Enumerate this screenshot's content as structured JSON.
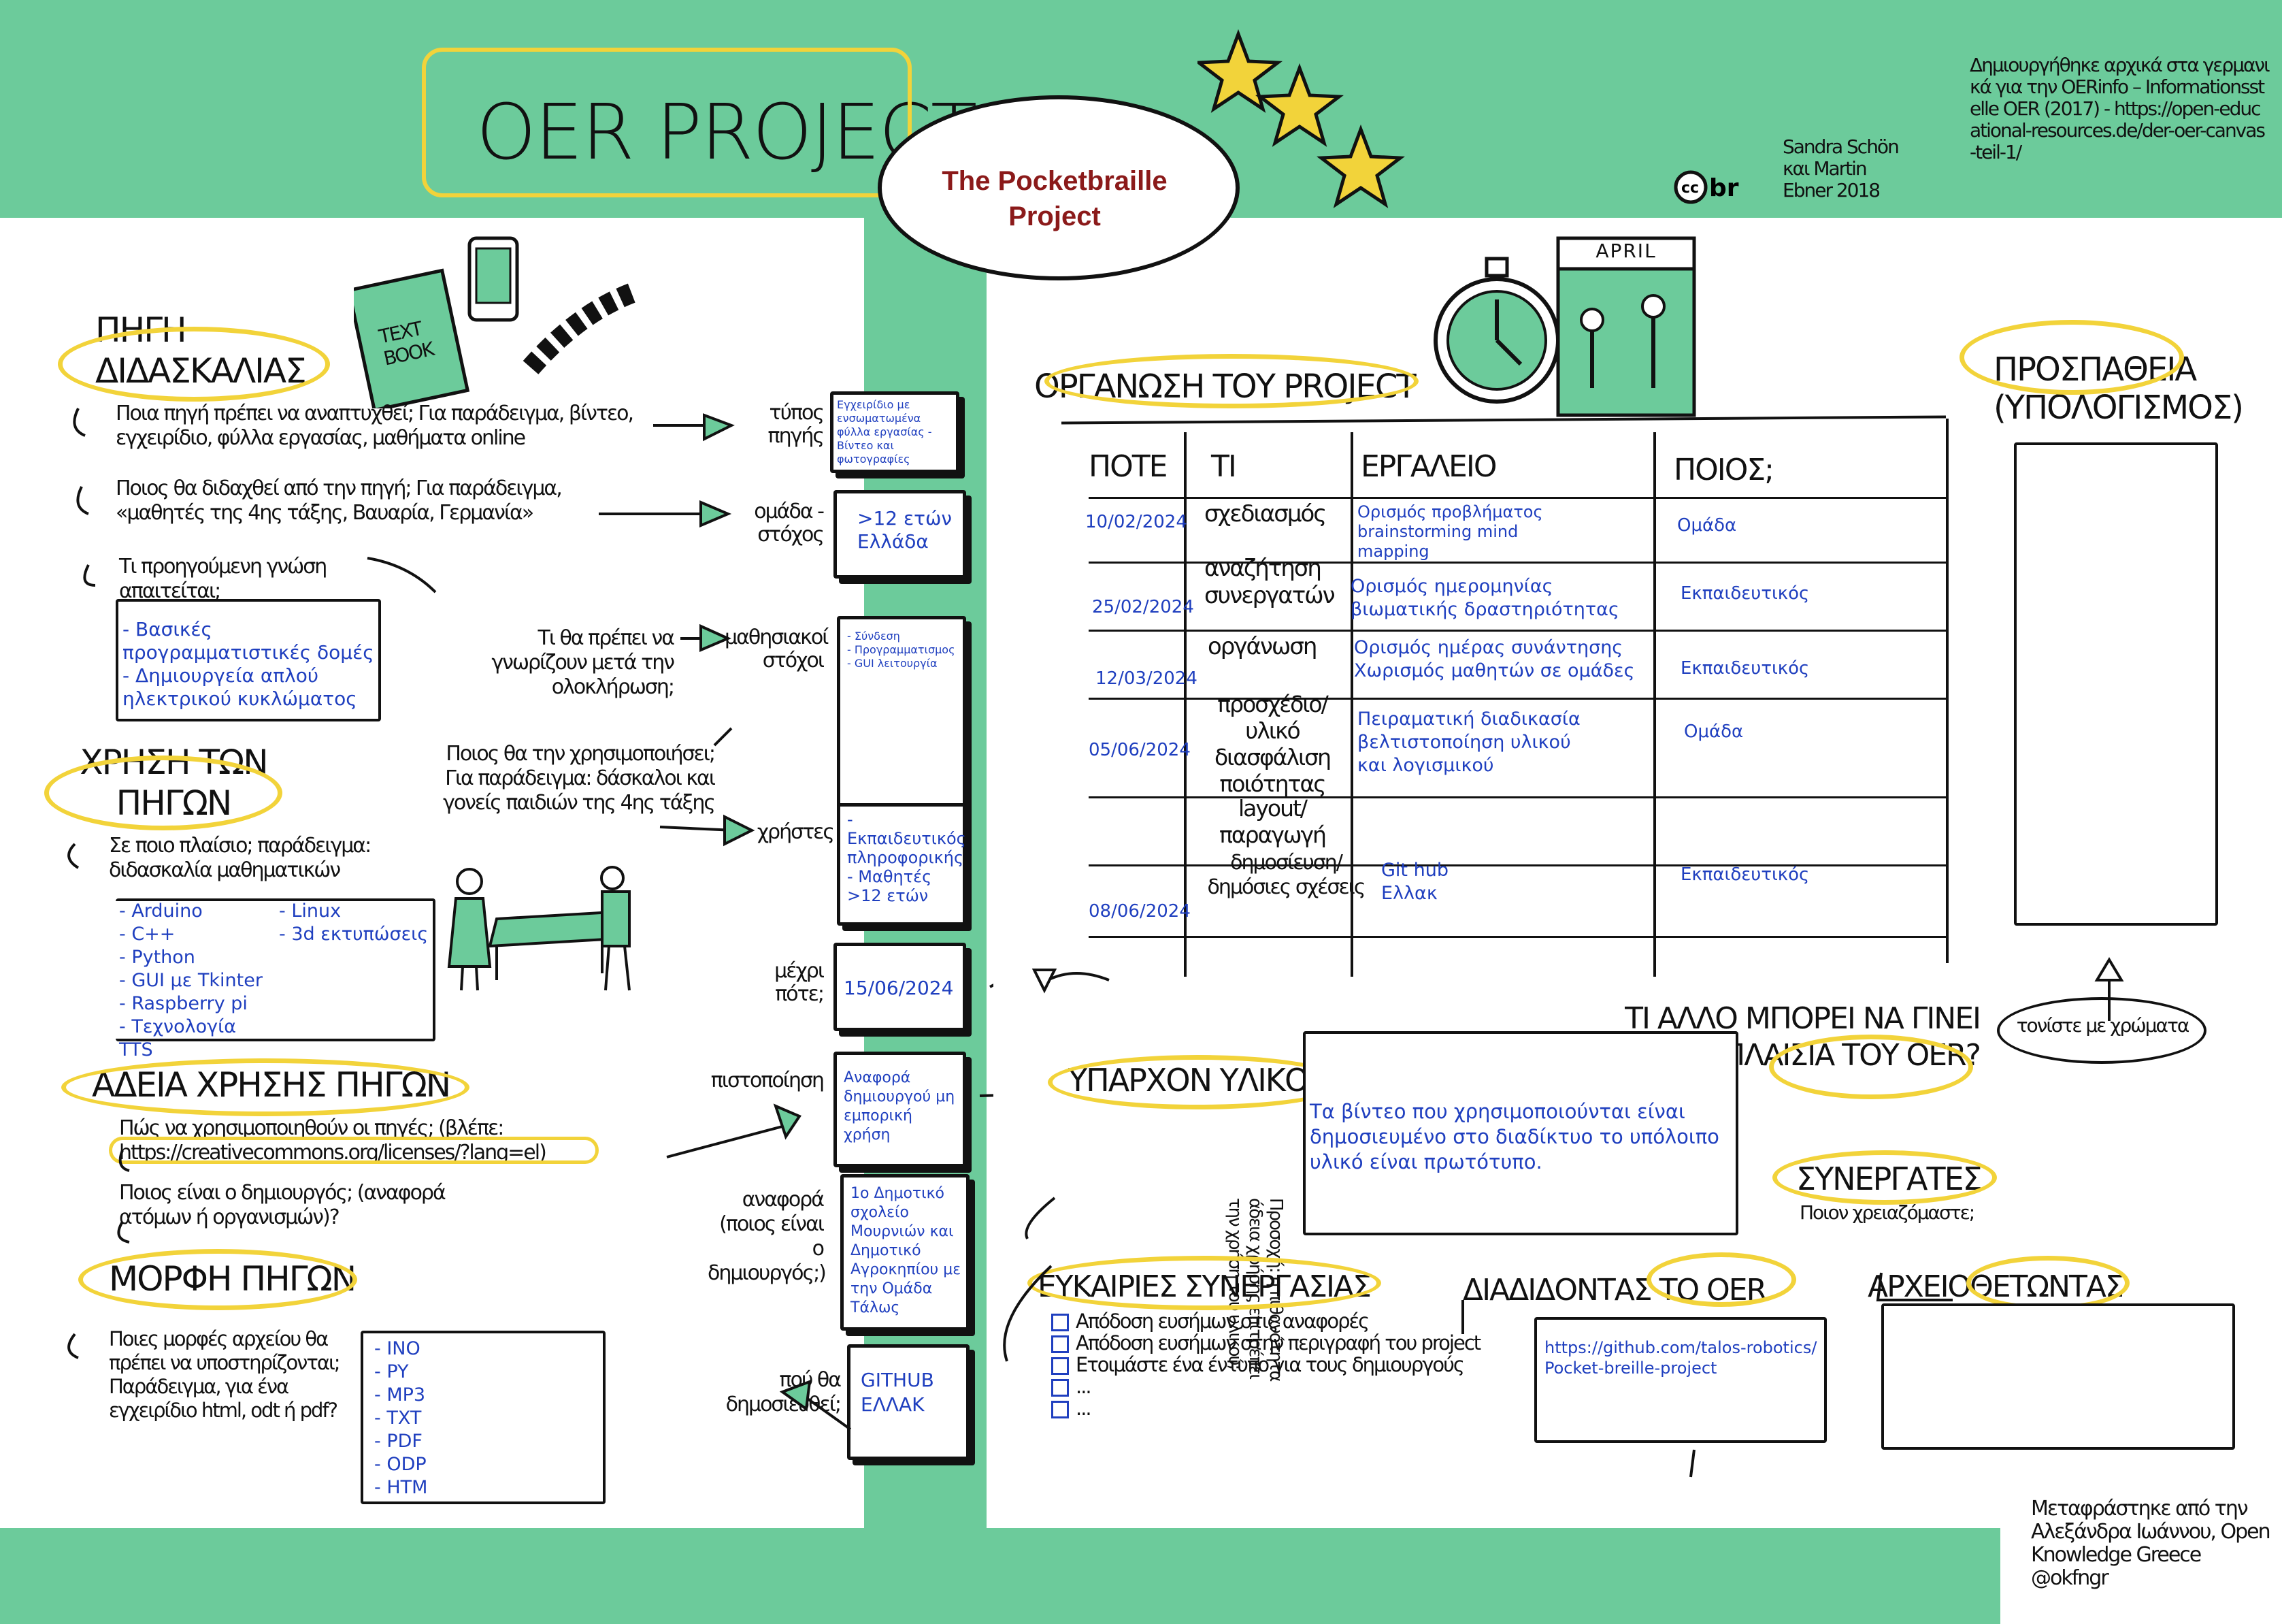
{
  "header": {
    "title": "OER PROJECT",
    "project_name": "The Pocketbraille Project",
    "authors": "Sandra Schön και Martin Ebner 2018",
    "credit": "Δημιουργήθηκε αρχικά στα γερμανικά για την OERinfo – Informationsstelle OER (2017) - https://open-educational-resources.de/der-oer-canvas-teil-1/"
  },
  "left": {
    "source_heading": "ΠΗΓΗ ΔΙΔΑΣΚΑΛΙΑΣ",
    "q_source_type": "Ποια πηγή πρέπει να αναπτυχθεί; Για παράδειγμα, βίντεο, εγχειρίδιο, φύλλα εργασίας, μαθήματα online",
    "label_type": "τύπος πηγής",
    "val_type": "Εγχειρίδιο με ενσωματωμένα φύλλα εργασίας - Βίντεο και φωτογραφίες",
    "q_target": "Ποιος θα διδαχθεί από την πηγή; Για παράδειγμα, «μαθητές της 4ης τάξης, Βαυαρία, Γερμανία»",
    "label_target": "ομάδα - στόχος",
    "val_target": ">12 ετών Ελλάδα",
    "q_prior": "Τι προηγούμενη γνώση απαιτείται;",
    "prior_items": [
      "- Βασικές προγραμματιστικές δομές",
      "- Δημιουργεία απλού ηλεκτρικού κυκλώματος"
    ],
    "q_learn": "Τι θα πρέπει να γνωρίζουν μετά την ολοκλήρωση;",
    "label_learn": "μαθησιακοί στόχοι",
    "learn_items": [
      "- Σύνδεση",
      "- Προγραμματισμος",
      "- GUI λειτουργία"
    ],
    "use_heading": "ΧΡΗΣΗ ΤΩΝ ΠΗΓΩΝ",
    "q_users": "Ποιος θα την χρησιμοποιήσει; Για παράδειγμα: δάσκαλοι και γονείς παιδιών της 4ης τάξης",
    "label_users": "χρήστες",
    "users_items": [
      "- Εκπαιδευτικός πληροφορικής",
      "- Μαθητές >12 ετών"
    ],
    "q_context": "Σε ποιο πλαίσιο; παράδειγμα: διδασκαλία μαθηματικών",
    "tools_col1": [
      "- Arduino",
      "- C++",
      "- Python",
      "- GUI με Tkinter",
      "- Raspberry pi",
      "- Τεχνολογία TTS"
    ],
    "tools_col2": [
      "- Linux",
      "- 3d εκτυπώσεις"
    ],
    "label_until": "μέχρι πότε;",
    "val_until": "15/06/2024",
    "license_heading": "ΑΔΕΙΑ ΧΡΗΣΗΣ ΠΗΓΩΝ",
    "label_cert": "πιστοποίηση",
    "val_cert": "Αναφορά δημιουργού μη εμπορική χρήση",
    "q_license": "Πώς να χρησιμοποιηθούν οι πηγές; (βλέπε: https://creativecommons.org/licenses/?lang=el)",
    "q_creator": "Ποιος είναι ο δημιουργός; (αναφορά ατόμων ή οργανισμών)?",
    "label_ref": "αναφορά (ποιος είναι ο δημιουργός;)",
    "val_ref": "1ο Δημοτικό σχολείο Μουρνιών και Δημοτικό Αγροκηπίου με την Ομάδα Τάλως",
    "format_heading": "ΜΟΡΦΗ ΠΗΓΩΝ",
    "q_format": "Ποιες μορφές αρχείου θα πρέπει να υποστηρίζονται; Παράδειγμα, για ένα εγχειρίδιο html, odt ή pdf?",
    "formats": [
      "- INO",
      "- PY",
      "- MP3",
      "- TXT",
      "- PDF",
      "- ODP",
      "- HTM"
    ],
    "label_publish": "πού θα δημοσιευθεί;",
    "val_publish": "GITHUB ΕΛΛΑΚ"
  },
  "org": {
    "heading": "ΟΡΓΑΝΩΣΗ ΤΟΥ PROJECT",
    "effort_heading": "ΠΡΟΣΠΑΘΕΙΑ (ΥΠΟΛΟΓΙΣΜΟΣ)",
    "col_when": "ΠΟΤΕ",
    "col_what": "ΤΙ",
    "col_tool": "ΕΡΓΑΛΕΙΟ",
    "col_who": "ΠΟΙΟΣ;",
    "rows": [
      {
        "date": "10/02/2024",
        "what": "σχεδιασμός",
        "tool": "Ορισμός προβλήματος brainstorming mind mapping",
        "who": "Ομάδα"
      },
      {
        "date": "25/02/2024",
        "what": "αναζήτηση συνεργατών",
        "tool": "Ορισμός ημερομηνίας βιωματικής δραστηριότητας",
        "who": "Εκπαιδευτικός"
      },
      {
        "date": "12/03/2024",
        "what": "οργάνωση",
        "tool": "Ορισμός ημέρας συνάντησης Χωρισμός μαθητών σε ομάδες",
        "who": "Εκπαιδευτικός"
      },
      {
        "date": "05/06/2024",
        "what": "προσχέδιο/ υλικό διασφάλιση ποιότητας",
        "tool": "Πειραματική διαδικασία βελτιστοποίηση υλικού και λογισμικού",
        "who": "Ομάδα"
      },
      {
        "date": "",
        "what": "layout/ παραγωγή",
        "tool": "",
        "who": ""
      },
      {
        "date": "08/06/2024",
        "what": "δημοσίευση/ δημόσιες σχέσεις",
        "tool": "Git hub Ελλακ",
        "who": "Εκπαιδευτικός"
      }
    ],
    "colour_note": "τονίστε με χρώματα",
    "more_heading": "ΤΙ ΑΛΛΟ ΜΠΟΡΕΙ ΝΑ ΓΙΝΕΙ ΣΤΑ ΠΛΑΙΣΙΑ ΤΟΥ OER?"
  },
  "material": {
    "heading": "ΥΠΑΡΧΟΝ ΥΛΙΚΟ",
    "rotated_note": "Προσοχή: η πιθανότητα άδεια χρήσης επιτρέπει την χρήση του υλικού;",
    "text": "Τα βίντεο που χρησιμοποιούνται είναι δημοσιευμένο στο διαδίκτυο το υπόλοιπο υλικό είναι πρωτότυπο."
  },
  "partners": {
    "heading": "ΣΥΝΕΡΓΑΤΕΣ",
    "sub": "Ποιον χρειαζόμαστε;"
  },
  "opportunities": {
    "heading": "ΕΥΚΑΙΡΙΕΣ ΣΥΝΕΡΓΑΣΙΑΣ",
    "items": [
      "Απόδοση ευσήμων στις αναφορές",
      "Απόδοση ευσήμων στην περιγραφή του project",
      "Ετοιμάστε ένα έντυπο για τους δημιουργούς",
      "...",
      "..."
    ]
  },
  "spreading": {
    "heading": "ΔΙΑΔΙΔΟΝΤΑΣ ΤΟ OER",
    "link": "https://github.com/talos-robotics/Pocket-breille-project"
  },
  "archive": {
    "heading": "ΑΡΧΕΙΟΘΕΤΩΝΤΑΣ"
  },
  "footer": {
    "translated": "Μεταφράστηκε από την Αλεξάνδρα Ιωάννου, Open Knowledge Greece @okfngr"
  },
  "calendar_label": "APRIL",
  "book_label": "TEXT BOOK",
  "colors": {
    "green": "#6ccb9b",
    "yellow": "#f2d33a",
    "blue": "#1f3fbf",
    "red": "#8b1a1a"
  }
}
